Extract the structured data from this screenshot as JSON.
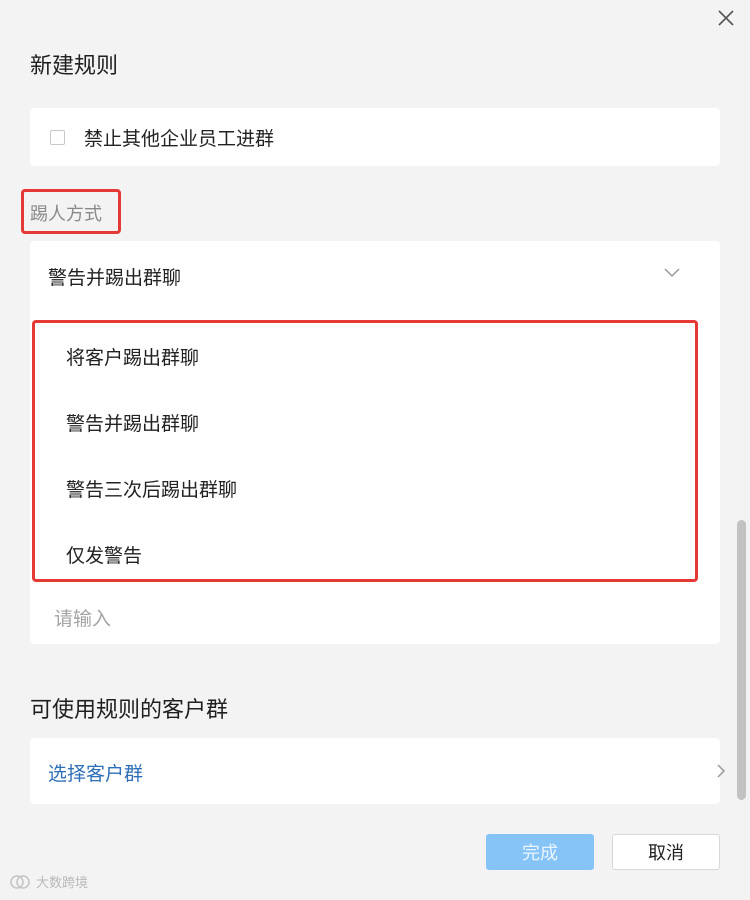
{
  "header": {
    "title": "新建规则"
  },
  "rule": {
    "checkbox_label": "禁止其他企业员工进群",
    "checked": false
  },
  "kick_section": {
    "label": "踢人方式",
    "selected": "警告并踢出群聊",
    "options": [
      "将客户踢出群聊",
      "警告并踢出群聊",
      "警告三次后踢出群聊",
      "仅发警告"
    ],
    "input_placeholder": "请输入"
  },
  "groups_section": {
    "title": "可使用规则的客户群",
    "select_label": "选择客户群"
  },
  "footer": {
    "done_label": "完成",
    "cancel_label": "取消"
  },
  "watermark": {
    "text": "大数跨境"
  },
  "colors": {
    "highlight": "#e53935",
    "link": "#2e6fb7",
    "primary_disabled": "#86c4f8"
  },
  "icons": {
    "close": "close-icon",
    "dropdown": "chevron-down-icon",
    "arrow": "chevron-right-icon"
  }
}
